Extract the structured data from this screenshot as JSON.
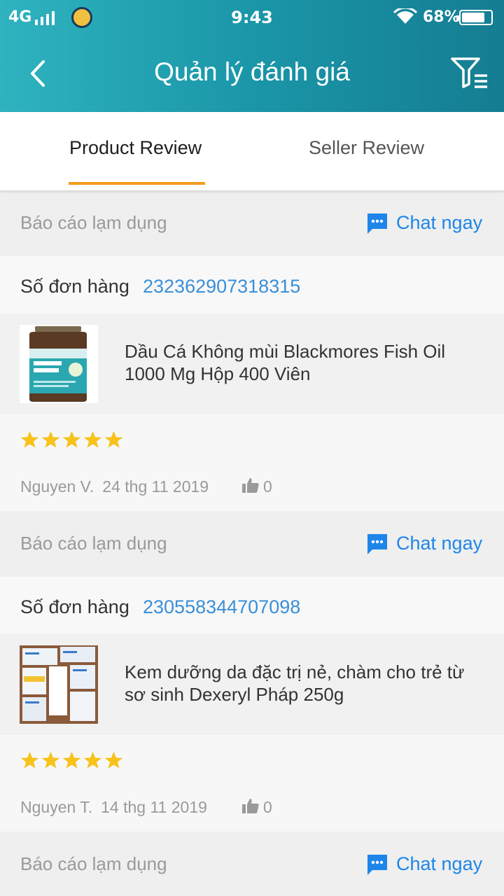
{
  "status_bar": {
    "network": "4G",
    "time": "9:43",
    "battery": "68%"
  },
  "header": {
    "title": "Quản lý đánh giá"
  },
  "tabs": [
    {
      "label": "Product Review",
      "active": true
    },
    {
      "label": "Seller Review",
      "active": false
    }
  ],
  "labels": {
    "report": "Báo cáo lạm dụng",
    "chat": "Chat ngay",
    "order_prefix": "Số đơn hàng"
  },
  "reviews": [
    {
      "order_number": "232362907318315",
      "product_name": "Dầu Cá Không mùi Blackmores Fish Oil 1000 Mg Hộp 400 Viên",
      "rating": 5,
      "reviewer": "Nguyen V.",
      "date": "24 thg 11 2019",
      "likes": "0"
    },
    {
      "order_number": "230558344707098",
      "product_name": "Kem dưỡng da đặc trị nẻ, chàm cho trẻ từ sơ sinh Dexeryl Pháp 250g",
      "rating": 5,
      "reviewer": "Nguyen T.",
      "date": "14 thg 11 2019",
      "likes": "0"
    }
  ],
  "colors": {
    "accent": "#1a96a8",
    "tab_underline": "#f39c1e",
    "link": "#3a8fd8",
    "chat": "#1e86e8",
    "star": "#f7c21b"
  },
  "icons": {
    "back": "chevron-left-icon",
    "filter": "filter-icon",
    "chat": "chat-bubble-icon",
    "star": "star-icon",
    "like": "thumbs-up-icon"
  }
}
